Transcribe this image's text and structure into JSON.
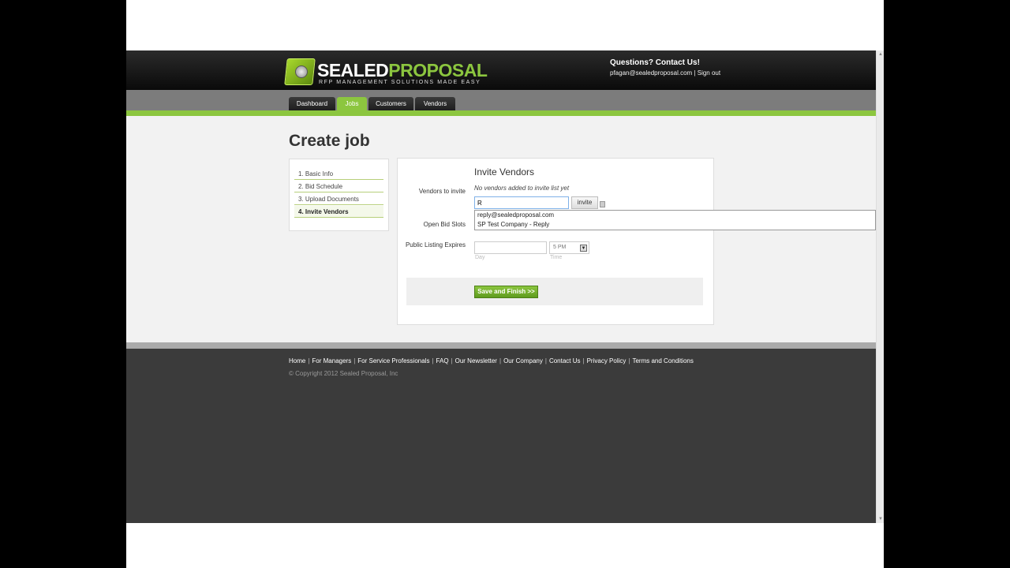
{
  "header": {
    "logo_word_1": "SEALED",
    "logo_word_2": "PROPOSAL",
    "logo_tagline": "RFP MANAGEMENT SOLUTIONS MADE EASY",
    "contact_title": "Questions? Contact Us!",
    "user_email": "pfagan@sealedproposal.com",
    "separator": "|",
    "signout_label": "Sign out"
  },
  "nav": {
    "tabs": [
      {
        "label": "Dashboard",
        "active": false
      },
      {
        "label": "Jobs",
        "active": true
      },
      {
        "label": "Customers",
        "active": false
      },
      {
        "label": "Vendors",
        "active": false
      }
    ]
  },
  "page": {
    "title": "Create job"
  },
  "steps": [
    {
      "label": "1. Basic Info",
      "active": false
    },
    {
      "label": "2. Bid Schedule",
      "active": false
    },
    {
      "label": "3. Upload Documents",
      "active": false
    },
    {
      "label": "4. Invite Vendors",
      "active": true
    }
  ],
  "form": {
    "heading": "Invite Vendors",
    "vendors_label": "Vendors to invite",
    "empty_note": "No vendors added to invite list yet",
    "vendor_input_value": "R",
    "invite_label": "invite",
    "open_slots_label": "Open Bid Slots",
    "listing_label": "Public Listing Expires",
    "day_value": "",
    "day_hint": "Day",
    "time_value": "5 PM",
    "time_hint": "Time",
    "time_arrow": "▼",
    "save_label": "Save and Finish >>"
  },
  "autocomplete": {
    "items": [
      "reply@sealedproposal.com",
      "SP Test Company - Reply"
    ]
  },
  "footer": {
    "links": [
      "Home",
      "For Managers",
      "For Service Professionals",
      "FAQ",
      "Our Newsletter",
      "Our Company",
      "Contact Us",
      "Privacy Policy",
      "Terms and Conditions"
    ],
    "copyright": "© Copyright 2012 Sealed Proposal, Inc"
  },
  "colors": {
    "accent": "#8cc63f",
    "header_bg": "#111111",
    "footer_bg": "#3b3b3b"
  }
}
